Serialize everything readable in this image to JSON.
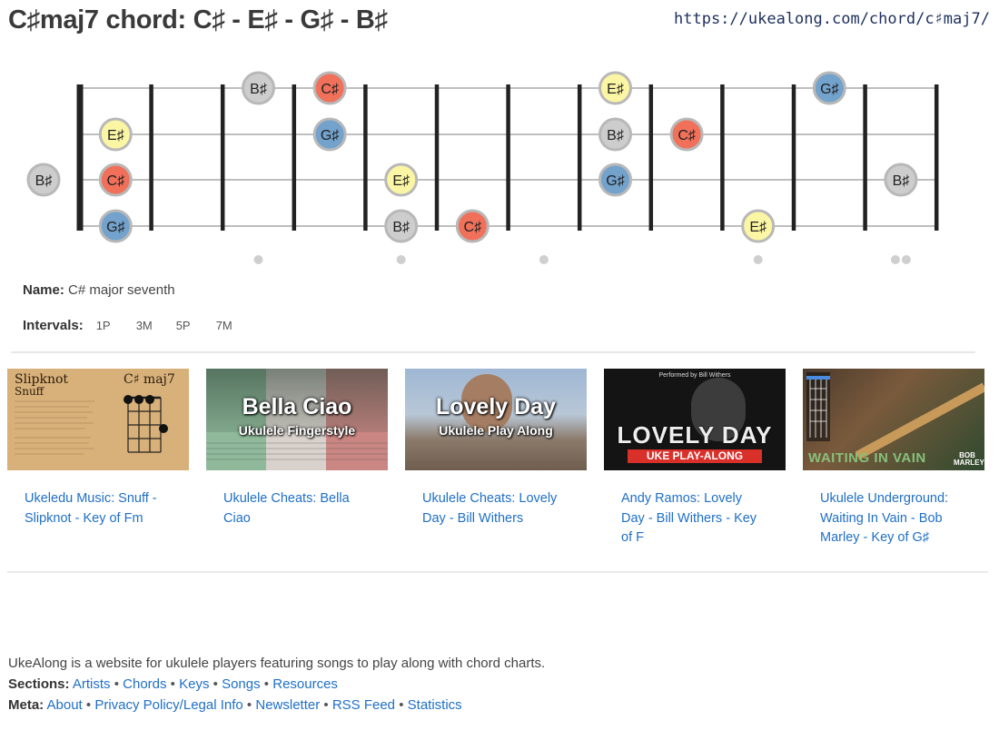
{
  "header": {
    "title": "C♯maj7 chord: C♯ - E♯ - G♯ - B♯",
    "url": "https://ukealong.com/chord/c♯maj7/"
  },
  "chord": {
    "name_label": "Name:",
    "name": "C# major seventh",
    "intervals_label": "Intervals:",
    "intervals": [
      "1P",
      "3M",
      "5P",
      "7M"
    ],
    "note_colors": {
      "C♯": "#f0705a",
      "E♯": "#fbf6a4",
      "G♯": "#73a2cc",
      "B♯": "#cdcdcd"
    },
    "fret_markers": [
      3,
      5,
      7,
      10,
      12
    ],
    "strings": [
      {
        "notes": [
          {
            "fret": 3,
            "label": "B♯"
          },
          {
            "fret": 4,
            "label": "C♯"
          },
          {
            "fret": 8,
            "label": "E♯"
          },
          {
            "fret": 11,
            "label": "G♯"
          }
        ]
      },
      {
        "notes": [
          {
            "fret": 1,
            "label": "E♯"
          },
          {
            "fret": 4,
            "label": "G♯"
          },
          {
            "fret": 8,
            "label": "B♯"
          },
          {
            "fret": 9,
            "label": "C♯"
          }
        ]
      },
      {
        "notes": [
          {
            "fret": 0,
            "label": "B♯"
          },
          {
            "fret": 1,
            "label": "C♯"
          },
          {
            "fret": 5,
            "label": "E♯"
          },
          {
            "fret": 8,
            "label": "G♯"
          },
          {
            "fret": 12,
            "label": "B♯"
          }
        ]
      },
      {
        "notes": [
          {
            "fret": 1,
            "label": "G♯"
          },
          {
            "fret": 5,
            "label": "B♯"
          },
          {
            "fret": 6,
            "label": "C♯"
          },
          {
            "fret": 10,
            "label": "E♯"
          }
        ]
      }
    ]
  },
  "videos": [
    {
      "link": "Ukeledu Music: Snuff - Slipknot - Key of Fm",
      "thumb_title": "Slipknot",
      "thumb_subtitle": "Snuff",
      "thumb_chord": "C♯ maj7"
    },
    {
      "link": "Ukulele Cheats: Bella Ciao",
      "thumb_title": "Bella Ciao",
      "thumb_subtitle": "Ukulele Fingerstyle"
    },
    {
      "link": "Ukulele Cheats: Lovely Day - Bill Withers",
      "thumb_title": "Lovely Day",
      "thumb_subtitle": "Ukulele Play Along"
    },
    {
      "link": "Andy Ramos: Lovely Day - Bill Withers - Key of F",
      "thumb_title": "LOVELY DAY",
      "thumb_subtitle": "UKE PLAY-ALONG",
      "thumb_top": "Performed by Bill Withers"
    },
    {
      "link": "Ukulele Underground: Waiting In Vain - Bob Marley - Key of G♯",
      "thumb_title": "WAITING IN VAIN",
      "thumb_badge": "BOB MARLEY"
    }
  ],
  "footer": {
    "about": "UkeAlong is a website for ukulele players featuring songs to play along with chord charts.",
    "sections_label": "Sections:",
    "sections": [
      "Artists",
      "Chords",
      "Keys",
      "Songs",
      "Resources"
    ],
    "meta_label": "Meta:",
    "meta": [
      "About",
      "Privacy Policy/Legal Info",
      "Newsletter",
      "RSS Feed",
      "Statistics"
    ],
    "separator": "•"
  }
}
